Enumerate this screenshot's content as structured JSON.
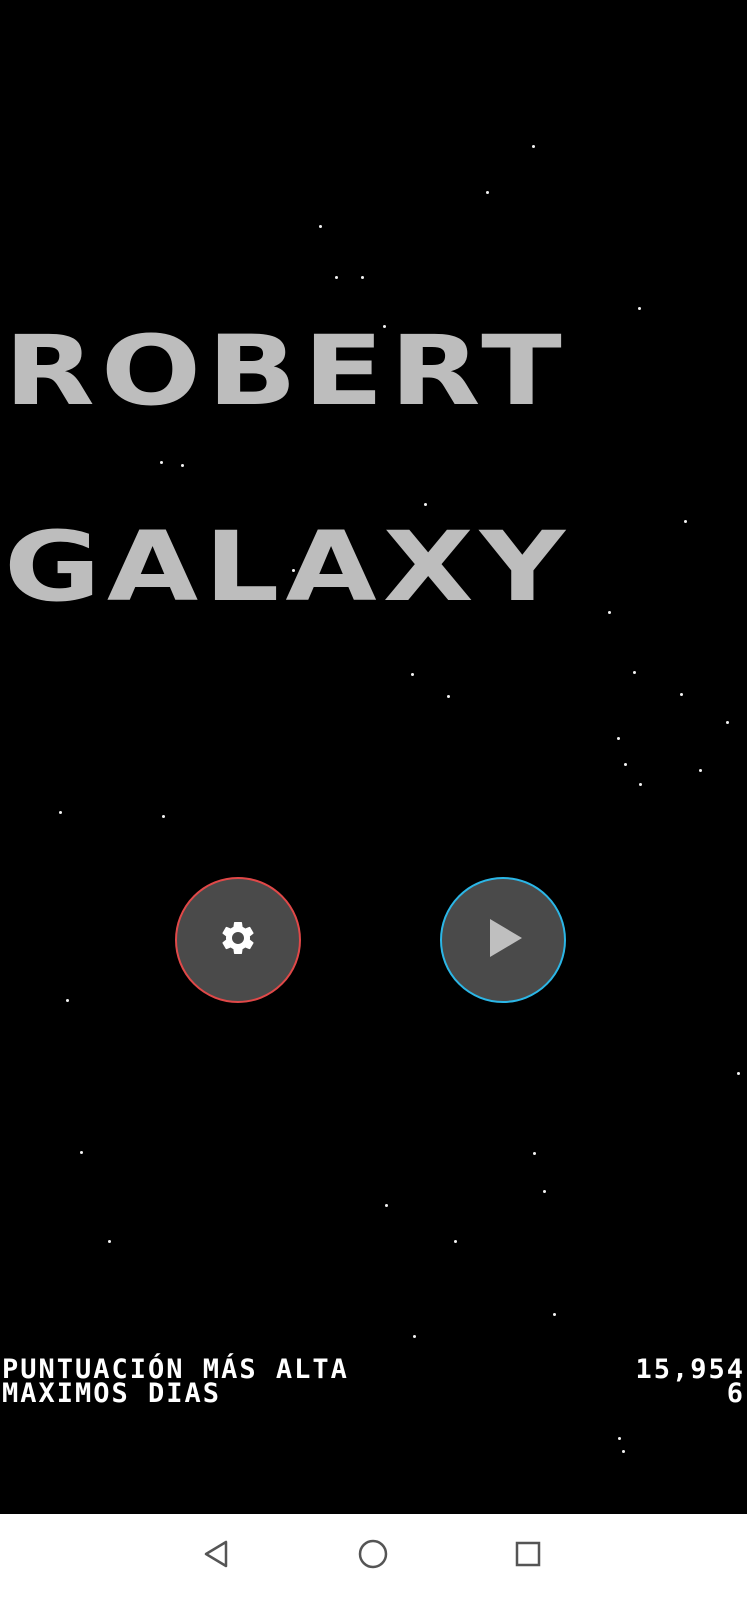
{
  "title": {
    "line1": "ROBERT",
    "line2": "GALAXY"
  },
  "buttons": {
    "settings_icon": "gear-icon",
    "play_icon": "play-icon",
    "settings_border_color": "#e04848",
    "play_border_color": "#2bb6e6",
    "fill_color": "#4a4a4a"
  },
  "stats": [
    {
      "label": "PUNTUACIÓN MÁS ALTA",
      "value": "15,954"
    },
    {
      "label": "MAXIMOS DIAS",
      "value": "6"
    }
  ],
  "nav": {
    "back_icon": "back-triangle-icon",
    "home_icon": "home-circle-icon",
    "recent_icon": "recent-apps-icon"
  }
}
